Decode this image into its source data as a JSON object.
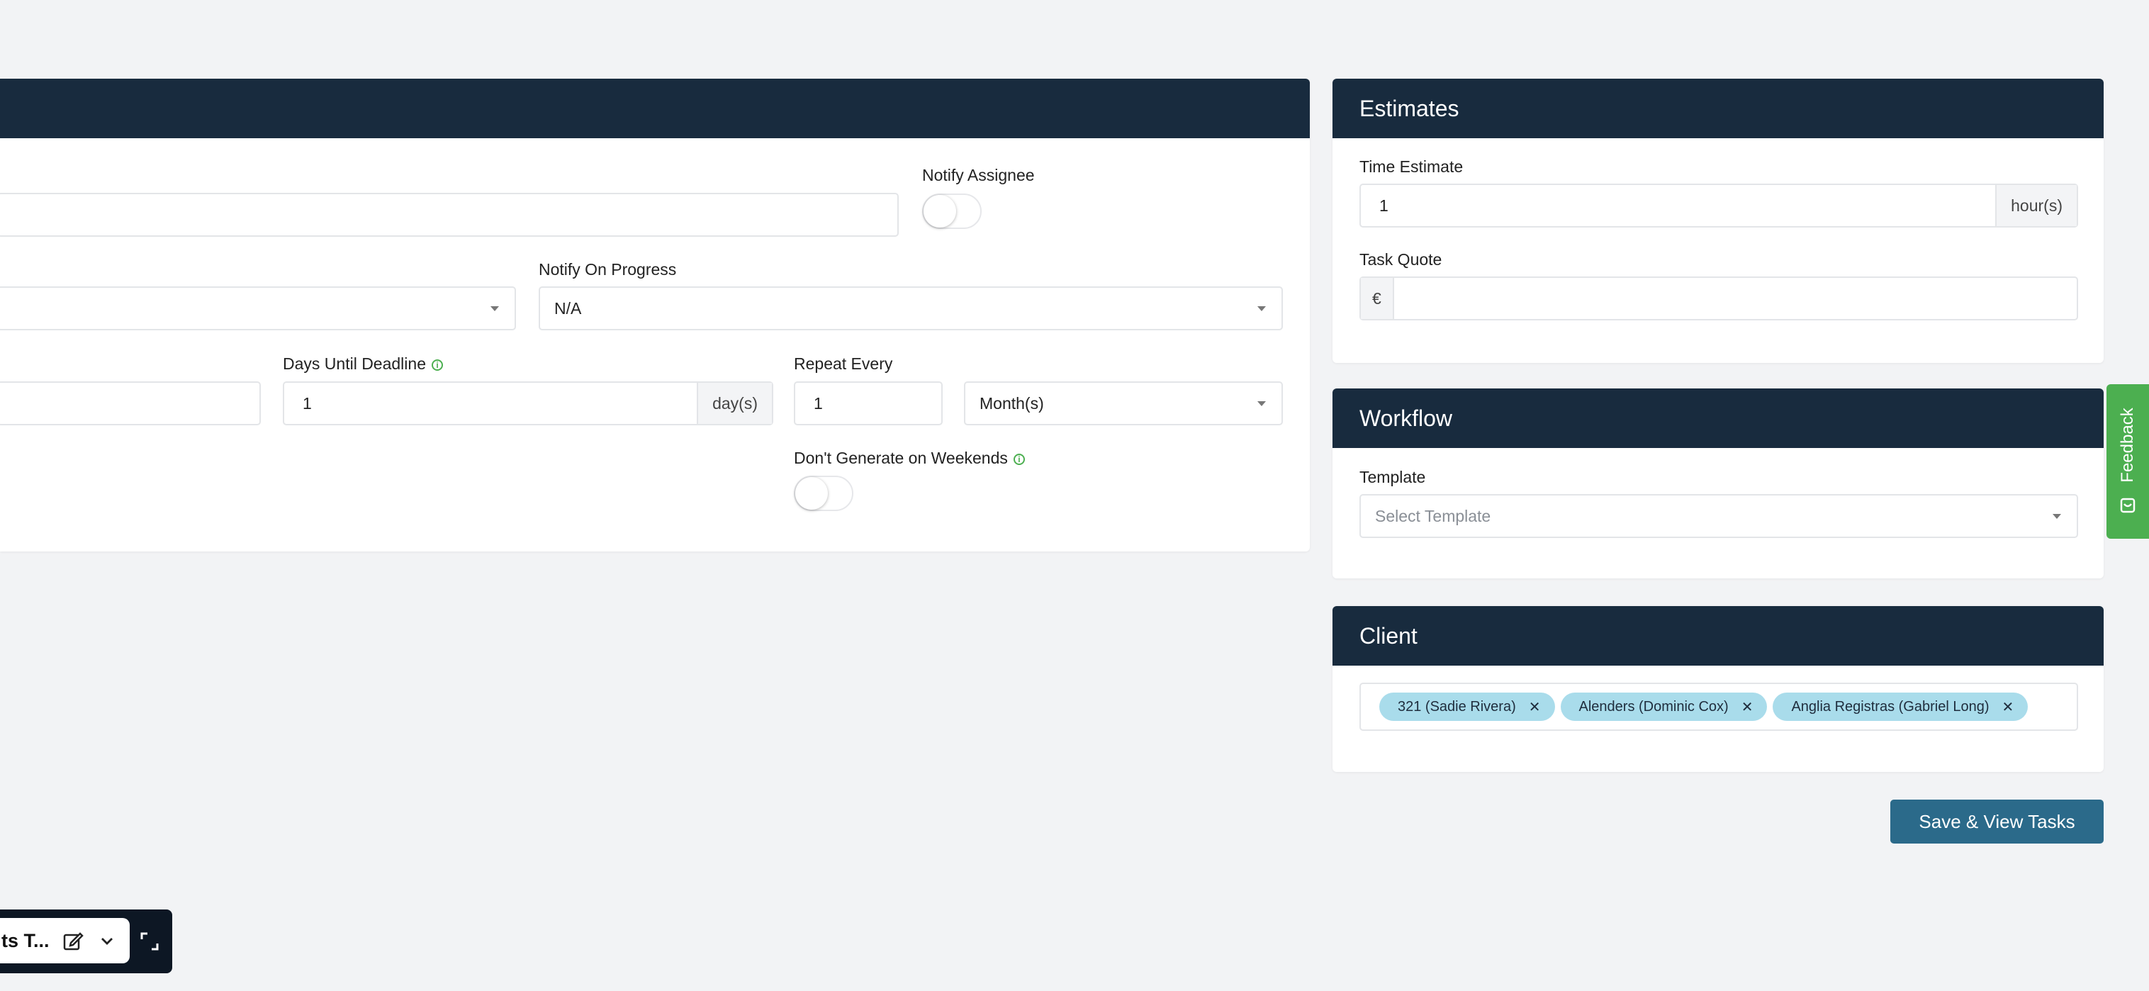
{
  "main_form": {
    "notify_assignee_label": "Notify Assignee",
    "notify_on_progress_label": "Notify On Progress",
    "notify_on_progress_value": "N/A",
    "days_until_deadline_label": "Days Until Deadline",
    "days_until_deadline_value": "1",
    "days_unit": "day(s)",
    "repeat_every_label": "Repeat Every",
    "repeat_every_value": "1",
    "repeat_unit_value": "Month(s)",
    "dont_generate_weekends_label": "Don't Generate on Weekends"
  },
  "estimates": {
    "title": "Estimates",
    "time_estimate_label": "Time Estimate",
    "time_estimate_value": "1",
    "time_unit": "hour(s)",
    "task_quote_label": "Task Quote",
    "currency_symbol": "€",
    "task_quote_value": ""
  },
  "workflow": {
    "title": "Workflow",
    "template_label": "Template",
    "template_placeholder": "Select Template"
  },
  "client": {
    "title": "Client",
    "tags": [
      {
        "label": "321 (Sadie Rivera)"
      },
      {
        "label": "Alenders (Dominic Cox)"
      },
      {
        "label": "Anglia Registras (Gabriel Long)"
      }
    ]
  },
  "save_button_label": "Save & View Tasks",
  "feedback_label": "Feedback",
  "bottom_bar": {
    "title": "ts T..."
  },
  "colors": {
    "header_bg": "#182b3e",
    "save_button_bg": "#2b6a8a",
    "tag_bg": "#a9dceb",
    "feedback_bg": "#4caf50"
  }
}
